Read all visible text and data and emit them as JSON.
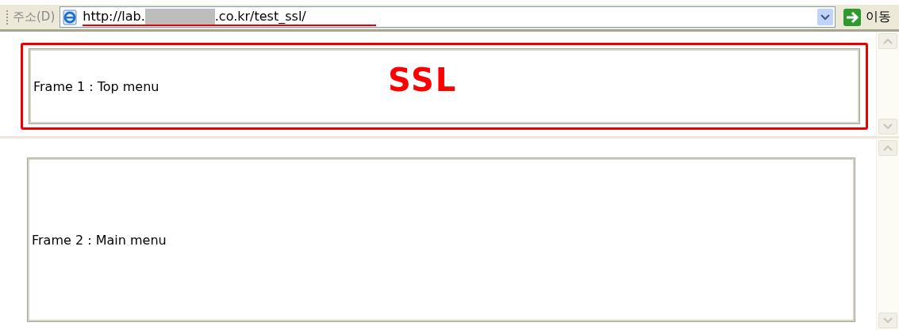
{
  "address_bar": {
    "label": "주소(D)",
    "url_start": "http://lab.",
    "url_redacted": true,
    "url_end": ".co.kr/test_ssl/",
    "go_button": "이동"
  },
  "frames": [
    {
      "label": "Frame 1 : Top menu",
      "annotation": "SSL",
      "highlighted": true
    },
    {
      "label": "Frame 2 : Main menu",
      "highlighted": false
    }
  ]
}
